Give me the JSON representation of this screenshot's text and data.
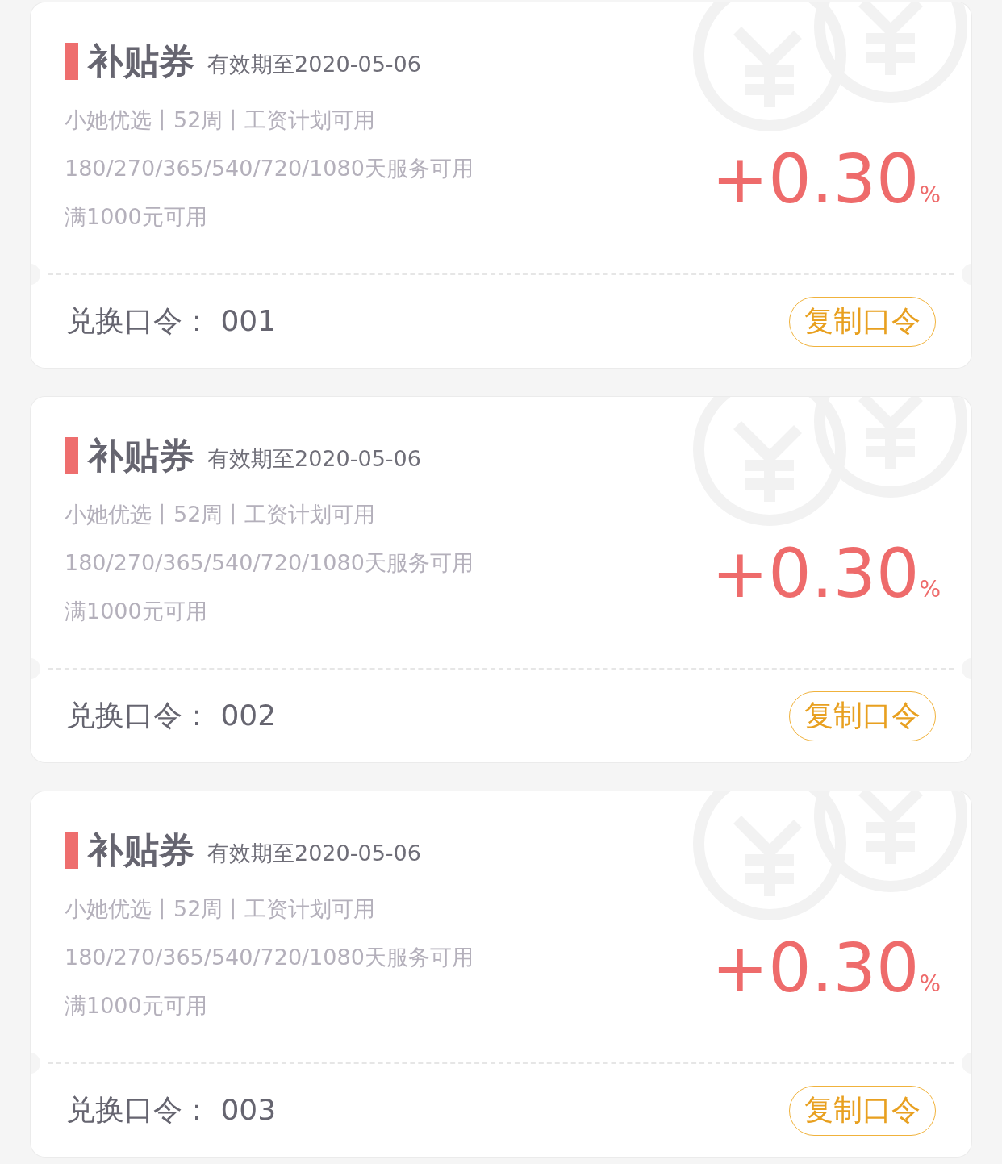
{
  "coupons": [
    {
      "title": "补贴券",
      "expiry": "有效期至2020-05-06",
      "lines": [
        "小她优选丨52周丨工资计划可用",
        "180/270/365/540/720/1080天服务可用",
        "满1000元可用"
      ],
      "value": "+0.30",
      "unit": "%",
      "code_label": "兑换口令：",
      "code": "001",
      "button": "复制口令"
    },
    {
      "title": "补贴券",
      "expiry": "有效期至2020-05-06",
      "lines": [
        "小她优选丨52周丨工资计划可用",
        "180/270/365/540/720/1080天服务可用",
        "满1000元可用"
      ],
      "value": "+0.30",
      "unit": "%",
      "code_label": "兑换口令：",
      "code": "002",
      "button": "复制口令"
    },
    {
      "title": "补贴券",
      "expiry": "有效期至2020-05-06",
      "lines": [
        "小她优选丨52周丨工资计划可用",
        "180/270/365/540/720/1080天服务可用",
        "满1000元可用"
      ],
      "value": "+0.30",
      "unit": "%",
      "code_label": "兑换口令：",
      "code": "003",
      "button": "复制口令"
    }
  ]
}
